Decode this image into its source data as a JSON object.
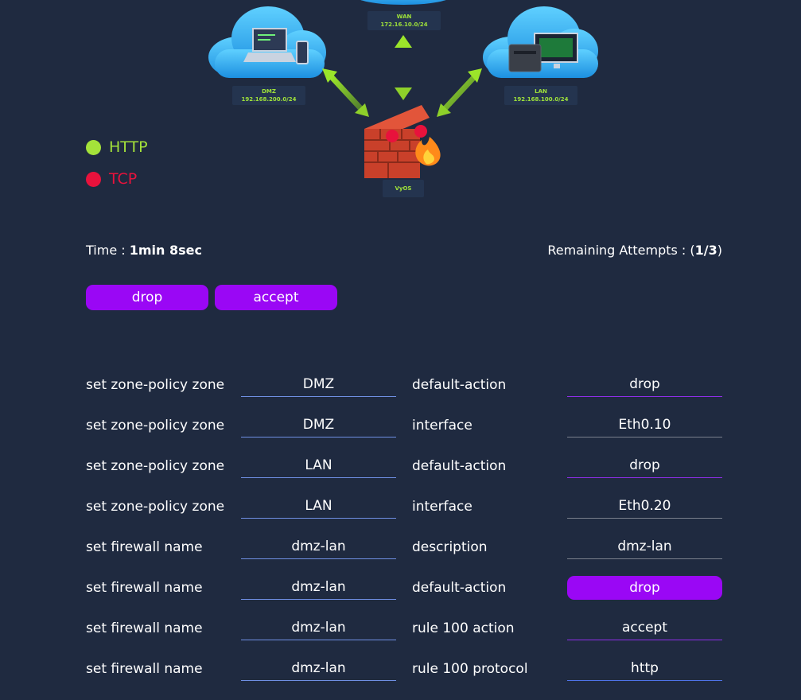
{
  "diagram": {
    "wan": {
      "name": "WAN",
      "subnet": "172.16.10.0/24"
    },
    "dmz": {
      "name": "DMZ",
      "subnet": "192.168.200.0/24"
    },
    "lan": {
      "name": "LAN",
      "subnet": "192.168.100.0/24"
    },
    "firewall": {
      "name": "VyOS"
    }
  },
  "legend": [
    {
      "label": "HTTP",
      "color": "#a4e23a"
    },
    {
      "label": "TCP",
      "color": "#e8123c"
    }
  ],
  "status": {
    "time_label": "Time : ",
    "time_value": "1min 8sec",
    "attempts_label": "Remaining Attempts : (",
    "attempts_value": "1/3",
    "attempts_close": ")"
  },
  "options": [
    "drop",
    "accept"
  ],
  "rows": [
    {
      "command": "set zone-policy zone",
      "name": "DMZ",
      "param": "default-action",
      "value": "drop",
      "style": "purple"
    },
    {
      "command": "set zone-policy zone",
      "name": "DMZ",
      "param": "interface",
      "value": "Eth0.10",
      "style": "gray"
    },
    {
      "command": "set zone-policy zone",
      "name": "LAN",
      "param": "default-action",
      "value": "drop",
      "style": "purple"
    },
    {
      "command": "set zone-policy zone",
      "name": "LAN",
      "param": "interface",
      "value": "Eth0.20",
      "style": "gray"
    },
    {
      "command": "set firewall name",
      "name": "dmz-lan",
      "param": "description",
      "value": "dmz-lan",
      "style": "gray"
    },
    {
      "command": "set firewall name",
      "name": "dmz-lan",
      "param": "default-action",
      "value": "drop",
      "style": "filled"
    },
    {
      "command": "set firewall name",
      "name": "dmz-lan",
      "param": "rule 100 action",
      "value": "accept",
      "style": "purple"
    },
    {
      "command": "set firewall name",
      "name": "dmz-lan",
      "param": "rule 100 protocol",
      "value": "http",
      "style": "blue"
    }
  ]
}
